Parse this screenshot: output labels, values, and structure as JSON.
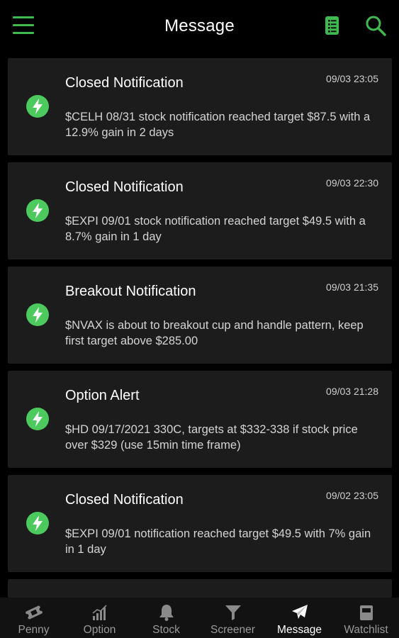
{
  "header": {
    "title": "Message",
    "menu_icon": "hamburger-menu-icon",
    "doc_icon": "document-list-icon",
    "search_icon": "search-icon",
    "accent_color": "#3fb950"
  },
  "messages": [
    {
      "title": "Closed Notification",
      "time": "09/03 23:05",
      "body": "$CELH 08/31 stock notification reached target $87.5 with a 12.9% gain in 2 days",
      "icon": "lightning-bolt-icon"
    },
    {
      "title": "Closed Notification",
      "time": "09/03 22:30",
      "body": "$EXPI 09/01 stock notification reached target $49.5 with a 8.7% gain in 1 day",
      "icon": "lightning-bolt-icon"
    },
    {
      "title": "Breakout Notification",
      "time": "09/03 21:35",
      "body": "$NVAX is about to breakout cup and handle pattern, keep first target above $285.00",
      "icon": "lightning-bolt-icon"
    },
    {
      "title": "Option Alert",
      "time": "09/03 21:28",
      "body": "$HD 09/17/2021 330C, targets at $332-338 if stock price over $329 (use 15min time frame)",
      "icon": "lightning-bolt-icon"
    },
    {
      "title": "Closed Notification",
      "time": "09/02 23:05",
      "body": "$EXPI 09/01 notification reached target $49.5 with 7% gain in 1 day",
      "icon": "lightning-bolt-icon"
    }
  ],
  "nav": {
    "items": [
      {
        "label": "Penny",
        "icon": "ticket-icon"
      },
      {
        "label": "Option",
        "icon": "bar-chart-icon"
      },
      {
        "label": "Stock",
        "icon": "bell-icon"
      },
      {
        "label": "Screener",
        "icon": "filter-icon"
      },
      {
        "label": "Message",
        "icon": "paper-plane-icon",
        "active": true
      },
      {
        "label": "Watchlist",
        "icon": "notebook-icon"
      }
    ]
  },
  "colors": {
    "background": "#000000",
    "card": "#1c1c1c",
    "bolt_green": "#4cca5e",
    "nav_background": "#121212"
  }
}
